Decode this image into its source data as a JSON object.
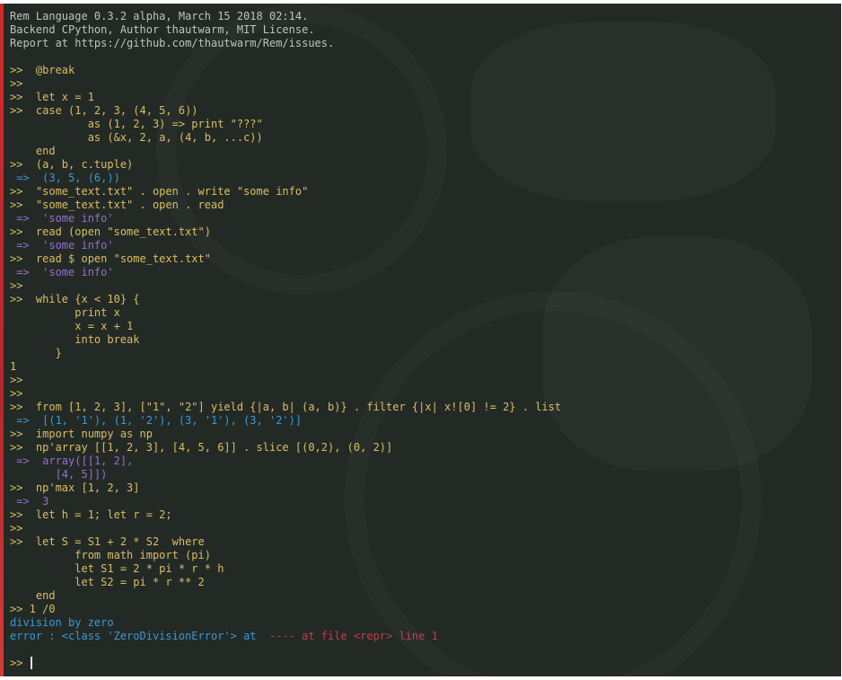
{
  "terminal": {
    "lines": [
      {
        "kind": "header",
        "text": "Rem Language 0.3.2 alpha, March 15 2018 02:14."
      },
      {
        "kind": "header",
        "text": "Backend CPython, Author thautwarm, MIT License."
      },
      {
        "kind": "header",
        "text": "Report at https://github.com/thautwarm/Rem/issues."
      },
      {
        "kind": "blank",
        "text": ""
      },
      {
        "kind": "prompt",
        "text": ">>  @break"
      },
      {
        "kind": "prompt",
        "text": ">>"
      },
      {
        "kind": "prompt",
        "text": ">>  let x = 1"
      },
      {
        "kind": "prompt",
        "text": ">>  case (1, 2, 3, (4, 5, 6))"
      },
      {
        "kind": "prompt",
        "text": "            as (1, 2, 3) => print \"???\""
      },
      {
        "kind": "prompt",
        "text": "            as (&x, 2, a, (4, b, ...c))"
      },
      {
        "kind": "prompt",
        "text": "    end"
      },
      {
        "kind": "prompt",
        "text": ">>  (a, b, c.tuple)"
      },
      {
        "kind": "result",
        "text": " =>  (3, 5, (6,))"
      },
      {
        "kind": "prompt",
        "text": ">>  \"some_text.txt\" . open . write \"some info\""
      },
      {
        "kind": "prompt",
        "text": ">>  \"some_text.txt\" . open . read"
      },
      {
        "kind": "result-str",
        "text": " =>  'some info'"
      },
      {
        "kind": "prompt",
        "text": ">>  read (open \"some_text.txt\")"
      },
      {
        "kind": "result-str",
        "text": " =>  'some info'"
      },
      {
        "kind": "prompt",
        "text": ">>  read $ open \"some_text.txt\""
      },
      {
        "kind": "result-str",
        "text": " =>  'some info'"
      },
      {
        "kind": "prompt",
        "text": ">>"
      },
      {
        "kind": "prompt",
        "text": ">>  while {x < 10} {"
      },
      {
        "kind": "prompt",
        "text": "          print x"
      },
      {
        "kind": "prompt",
        "text": "          x = x + 1"
      },
      {
        "kind": "prompt",
        "text": "          into break"
      },
      {
        "kind": "prompt",
        "text": "       }"
      },
      {
        "kind": "output",
        "text": "1"
      },
      {
        "kind": "prompt",
        "text": ">>"
      },
      {
        "kind": "prompt",
        "text": ">>"
      },
      {
        "kind": "prompt",
        "text": ">>  from [1, 2, 3], [\"1\", \"2\"] yield {|a, b| (a, b)} . filter {|x| x![0] != 2} . list"
      },
      {
        "kind": "result",
        "text": " =>  [(1, '1'), (1, '2'), (3, '1'), (3, '2')]"
      },
      {
        "kind": "prompt",
        "text": ">>  import numpy as np"
      },
      {
        "kind": "prompt",
        "text": ">>  np'array [[1, 2, 3], [4, 5, 6]] . slice [(0,2), (0, 2)]"
      },
      {
        "kind": "result-str",
        "text": " =>  array([[1, 2],"
      },
      {
        "kind": "result-str",
        "text": "       [4, 5]])"
      },
      {
        "kind": "prompt",
        "text": ">>  np'max [1, 2, 3]"
      },
      {
        "kind": "result-str",
        "text": " =>  3"
      },
      {
        "kind": "prompt",
        "text": ">>  let h = 1; let r = 2;"
      },
      {
        "kind": "prompt",
        "text": ">>"
      },
      {
        "kind": "prompt",
        "text": ">>  let S = S1 + 2 * S2  where"
      },
      {
        "kind": "prompt",
        "text": "          from math import (pi)"
      },
      {
        "kind": "prompt",
        "text": "          let S1 = 2 * pi * r * h"
      },
      {
        "kind": "prompt",
        "text": "          let S2 = pi * r ** 2"
      },
      {
        "kind": "prompt",
        "text": "    end"
      },
      {
        "kind": "prompt",
        "text": ">> 1 /0"
      },
      {
        "kind": "info",
        "text": "division by zero"
      },
      {
        "kind": "error",
        "text_a": "error : <class 'ZeroDivisionError'> at  ",
        "text_b": "---- at file <repr> line 1"
      },
      {
        "kind": "blank",
        "text": ""
      },
      {
        "kind": "input",
        "text": ">> "
      }
    ]
  },
  "colors": {
    "background": "#232a26",
    "prompt_text": "#dcbd62",
    "result_text": "#3c97d4",
    "string_result_text": "#9b6bd1",
    "error_location": "#c43a4f",
    "header_text": "#bcc4c0"
  }
}
